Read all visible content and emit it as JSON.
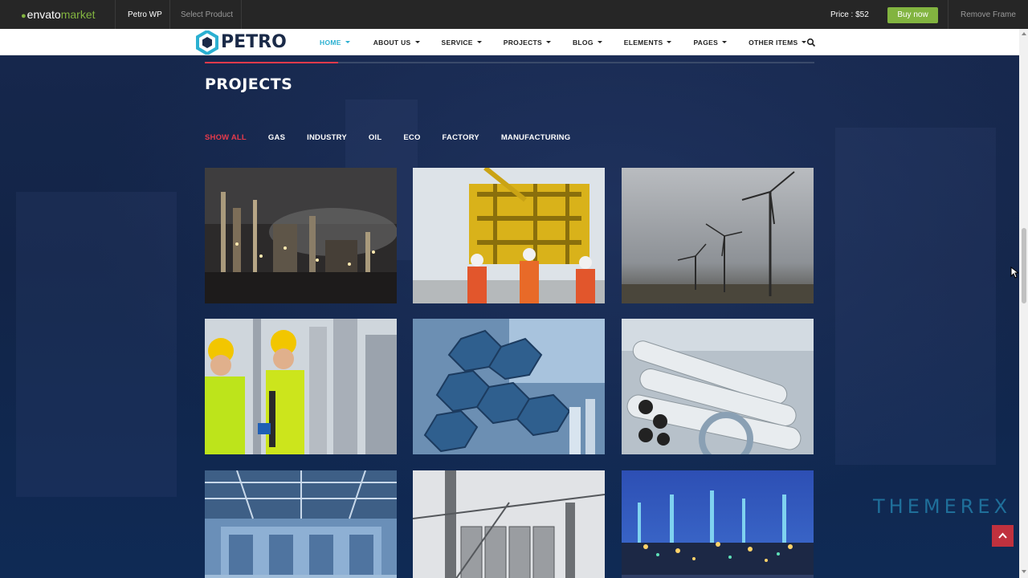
{
  "topbar": {
    "logo_envato": "envato",
    "logo_market": "market",
    "product": "Petro WP",
    "select_product": "Select Product",
    "price": "Price : $52",
    "buy_now": "Buy now",
    "remove_frame": "Remove Frame"
  },
  "brand": {
    "name": "PETRO"
  },
  "menu": [
    {
      "label": "HOME"
    },
    {
      "label": "ABOUT US"
    },
    {
      "label": "SERVICE"
    },
    {
      "label": "PROJECTS"
    },
    {
      "label": "BLOG"
    },
    {
      "label": "ELEMENTS"
    },
    {
      "label": "PAGES"
    },
    {
      "label": "OTHER ITEMS"
    }
  ],
  "section": {
    "title": "PROJECTS"
  },
  "filters": [
    {
      "label": "SHOW ALL"
    },
    {
      "label": "GAS"
    },
    {
      "label": "INDUSTRY"
    },
    {
      "label": "OIL"
    },
    {
      "label": "ECO"
    },
    {
      "label": "FACTORY"
    },
    {
      "label": "MANUFACTURING"
    }
  ],
  "projects": [
    {
      "image": "refinery-at-night"
    },
    {
      "image": "offshore-rig-workers"
    },
    {
      "image": "wind-turbines"
    },
    {
      "image": "engineers-handshake"
    },
    {
      "image": "hexagonal-mirror-panels"
    },
    {
      "image": "industrial-pipes"
    },
    {
      "image": "warehouse-interior"
    },
    {
      "image": "grain-silos"
    },
    {
      "image": "refinery-lights"
    }
  ],
  "watermark": "THEMEREX",
  "colors": {
    "accent": "#2bb0d1",
    "filter_active": "#e83a4b",
    "buy_button": "#82b440",
    "background": "#0e2145"
  }
}
